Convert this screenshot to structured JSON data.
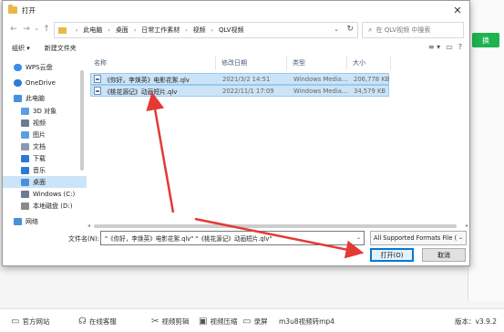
{
  "dialog": {
    "title": "打开",
    "close_glyph": "✕"
  },
  "nav": {
    "back": "←",
    "forward": "→",
    "up_dropdown": "⌄",
    "up": "↑",
    "refresh": "↻",
    "breadcrumb": [
      "此电脑",
      "桌面",
      "日常工作素材",
      "视频",
      "QLV视频"
    ],
    "search_placeholder": "在 QLV视频 中搜索"
  },
  "toolbar": {
    "organize": "组织 ▾",
    "new_folder": "新建文件夹",
    "view_icon": "≡ ▾",
    "pane_icon": "▭",
    "help_icon": "?"
  },
  "sidebar": {
    "items": [
      {
        "label": "WPS云盘",
        "color": "#3a8ee6"
      },
      {
        "label": "OneDrive",
        "color": "#2a7bd4"
      },
      {
        "label": "此电脑",
        "color": "#4a90d9"
      },
      {
        "label": "3D 对象",
        "color": "#5aa0e0"
      },
      {
        "label": "视频",
        "color": "#6a7b95"
      },
      {
        "label": "图片",
        "color": "#5aa0e0"
      },
      {
        "label": "文档",
        "color": "#8a9ab5"
      },
      {
        "label": "下载",
        "color": "#2a7bd4"
      },
      {
        "label": "音乐",
        "color": "#2a7bd4"
      },
      {
        "label": "桌面",
        "color": "#4a90d9"
      },
      {
        "label": "Windows (C:)",
        "color": "#6a7b95"
      },
      {
        "label": "本地磁盘 (D:)",
        "color": "#8a8a8a"
      },
      {
        "label": "网络",
        "color": "#4a90d9"
      }
    ],
    "selected_index": 9
  },
  "filelist": {
    "columns": [
      "名称",
      "修改日期",
      "类型",
      "大小"
    ],
    "rows": [
      {
        "name": "《你好，李焕英》电影花絮.qlv",
        "date": "2021/3/2 14:51",
        "type": "Windows Media...",
        "size": "206,778 KB"
      },
      {
        "name": "《桃花源记》动画短片.qlv",
        "date": "2022/11/1 17:09",
        "type": "Windows Media...",
        "size": "34,579 KB"
      }
    ]
  },
  "bottom": {
    "filename_label": "文件名(N):",
    "filename_value": "\"《你好，李焕英》电影花絮.qlv\" \"《桃花源记》动画短片.qlv\"",
    "filetype_value": "All Supported Formats File (",
    "open_label": "打开(O)",
    "cancel_label": "取消"
  },
  "app": {
    "green_button": "换",
    "bottom_items": [
      "官方网站",
      "在线客服",
      "视频剪辑",
      "视频压缩",
      "录屏",
      "m3u8视频转mp4"
    ],
    "version": "版本：v3.9.2"
  },
  "colors": {
    "accent": "#0078d7",
    "selection": "#cce4f7",
    "arrow": "#e53935"
  }
}
